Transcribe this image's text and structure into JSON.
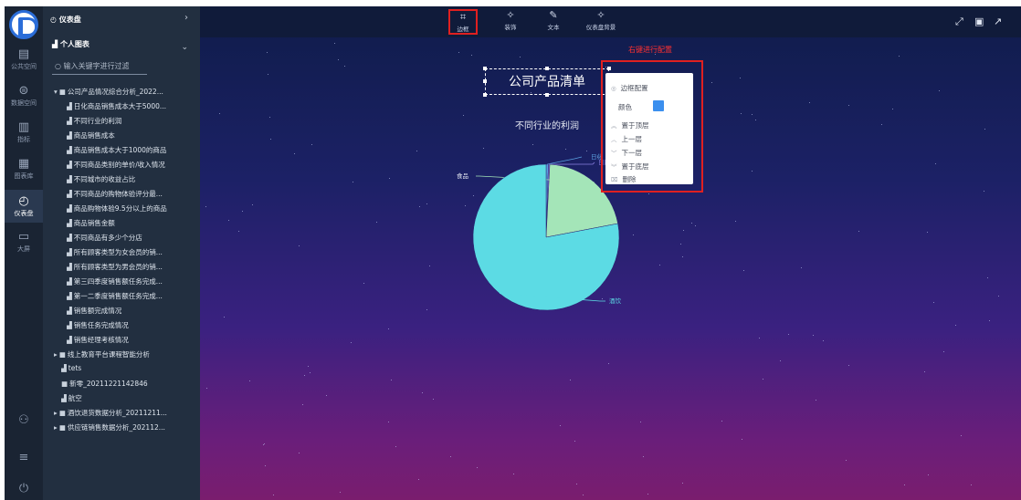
{
  "rail": {
    "items": [
      {
        "label": "公共空间",
        "icon": "document-icon"
      },
      {
        "label": "数据空间",
        "icon": "database-icon"
      },
      {
        "label": "指标",
        "icon": "bar-chart-icon"
      },
      {
        "label": "图表库",
        "icon": "chart-library-icon"
      },
      {
        "label": "仪表盘",
        "icon": "gauge-icon"
      },
      {
        "label": "大屏",
        "icon": "monitor-icon"
      }
    ],
    "bottom_icons": [
      "user-icon",
      "settings-sliders-icon",
      "power-icon"
    ]
  },
  "tree": {
    "header": "仪表盘",
    "section": "个人图表",
    "search_placeholder": "输入关键字进行过滤",
    "items": [
      "公司产品情况综合分析_2022...",
      "日化商品销售成本大于5000...",
      "不同行业的利润",
      "商品销售成本",
      "商品销售成本大于1000的商品",
      "不同商品类别的单价/收入情况",
      "不同城市的收益占比",
      "不同商品的购物体验评分最...",
      "商品购物体验9.5分以上的商品",
      "商品销售金额",
      "不同商品有多少个分店",
      "所有顾客类型为女会员的销...",
      "所有顾客类型为男会员的销...",
      "第三四季度销售额任务完成...",
      "第一二季度销售额任务完成...",
      "销售额完成情况",
      "销售任务完成情况",
      "销售经理考核情况",
      "线上教育平台课程智能分析",
      "tets",
      "新零_20211221142846",
      "航空",
      "酒饮退货数据分析_20211211...",
      "供应链销售数据分析_202112..."
    ]
  },
  "toolbar": {
    "tools": [
      "边框",
      "装饰",
      "文本",
      "仪表盘背景"
    ]
  },
  "canvas": {
    "title": "公司产品清单",
    "annotation": "右键进行配置",
    "context_menu": {
      "items": [
        "边框配置",
        "颜色",
        "置于顶层",
        "上一层",
        "下一层",
        "置于底层",
        "删除"
      ]
    }
  },
  "chart_data": {
    "type": "pie",
    "title": "不同行业的利润",
    "categories": [
      "日化",
      "日用",
      "食品",
      "酒饮"
    ],
    "values": [
      0.5,
      0.3,
      21.2,
      78.0
    ],
    "colors": [
      "#5aa0e0",
      "#8a7fe0",
      "#a4e5b8",
      "#5cdbe4"
    ]
  }
}
